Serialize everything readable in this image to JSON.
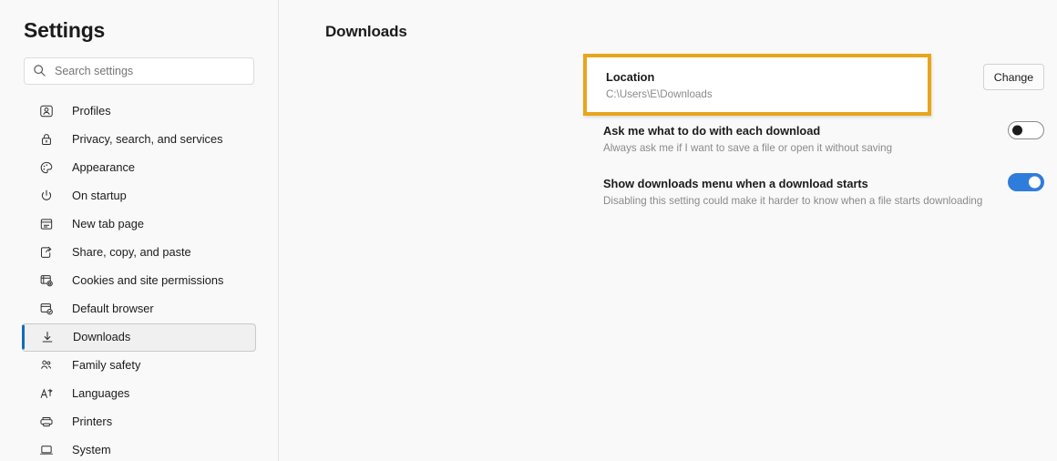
{
  "sidebar": {
    "title": "Settings",
    "search": {
      "placeholder": "Search settings",
      "value": "",
      "icon": "search-icon"
    },
    "items": [
      {
        "label": "Profiles",
        "icon": "profile-card-icon",
        "selected": false
      },
      {
        "label": "Privacy, search, and services",
        "icon": "lock-icon",
        "selected": false
      },
      {
        "label": "Appearance",
        "icon": "palette-icon",
        "selected": false
      },
      {
        "label": "On startup",
        "icon": "power-icon",
        "selected": false
      },
      {
        "label": "New tab page",
        "icon": "new-tab-page-icon",
        "selected": false
      },
      {
        "label": "Share, copy, and paste",
        "icon": "share-icon",
        "selected": false
      },
      {
        "label": "Cookies and site permissions",
        "icon": "cookies-gear-icon",
        "selected": false
      },
      {
        "label": "Default browser",
        "icon": "browser-check-icon",
        "selected": false
      },
      {
        "label": "Downloads",
        "icon": "download-arrow-icon",
        "selected": true
      },
      {
        "label": "Family safety",
        "icon": "family-people-icon",
        "selected": false
      },
      {
        "label": "Languages",
        "icon": "languages-icon",
        "selected": false
      },
      {
        "label": "Printers",
        "icon": "printer-icon",
        "selected": false
      },
      {
        "label": "System",
        "icon": "laptop-icon",
        "selected": false
      }
    ]
  },
  "main": {
    "page_title": "Downloads",
    "location": {
      "title": "Location",
      "path": "C:\\Users\\E\\Downloads",
      "change_label": "Change",
      "highlighted": true,
      "highlight_color": "#e8a51b"
    },
    "settings": [
      {
        "title": "Ask me what to do with each download",
        "description": "Always ask me if I want to save a file or open it without saving",
        "toggle_state": "off"
      },
      {
        "title": "Show downloads menu when a download starts",
        "description": "Disabling this setting could make it harder to know when a file starts downloading",
        "toggle_state": "on"
      }
    ]
  },
  "colors": {
    "accent_blue": "#2f7ddb",
    "selection_bar": "#0f6cbd",
    "highlight_amber": "#e8a51b",
    "page_background": "#f9f9f9",
    "card_white": "#ffffff"
  }
}
